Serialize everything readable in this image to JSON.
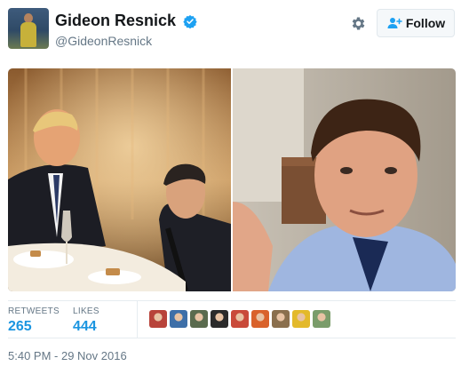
{
  "user": {
    "display_name": "Gideon Resnick",
    "handle": "@GideonResnick",
    "verified": true
  },
  "header": {
    "follow_label": "Follow"
  },
  "media": {
    "photos": [
      {
        "name": "photo-left"
      },
      {
        "name": "photo-right"
      }
    ]
  },
  "stats": {
    "retweets_label": "RETWEETS",
    "retweets_count": "265",
    "likes_label": "LIKES",
    "likes_count": "444"
  },
  "likers": [
    {
      "color": "#b8433a"
    },
    {
      "color": "#3e6fa8"
    },
    {
      "color": "#5a6b4e"
    },
    {
      "color": "#2b2b2b"
    },
    {
      "color": "#c94a3a"
    },
    {
      "color": "#d9622b"
    },
    {
      "color": "#8a6f4d"
    },
    {
      "color": "#e3b92b"
    },
    {
      "color": "#7a9c6a"
    }
  ],
  "timestamp": "5:40 PM - 29 Nov 2016",
  "colors": {
    "link_blue": "#1b95e0",
    "muted_gray": "#657786",
    "verified_blue": "#1da1f2"
  }
}
